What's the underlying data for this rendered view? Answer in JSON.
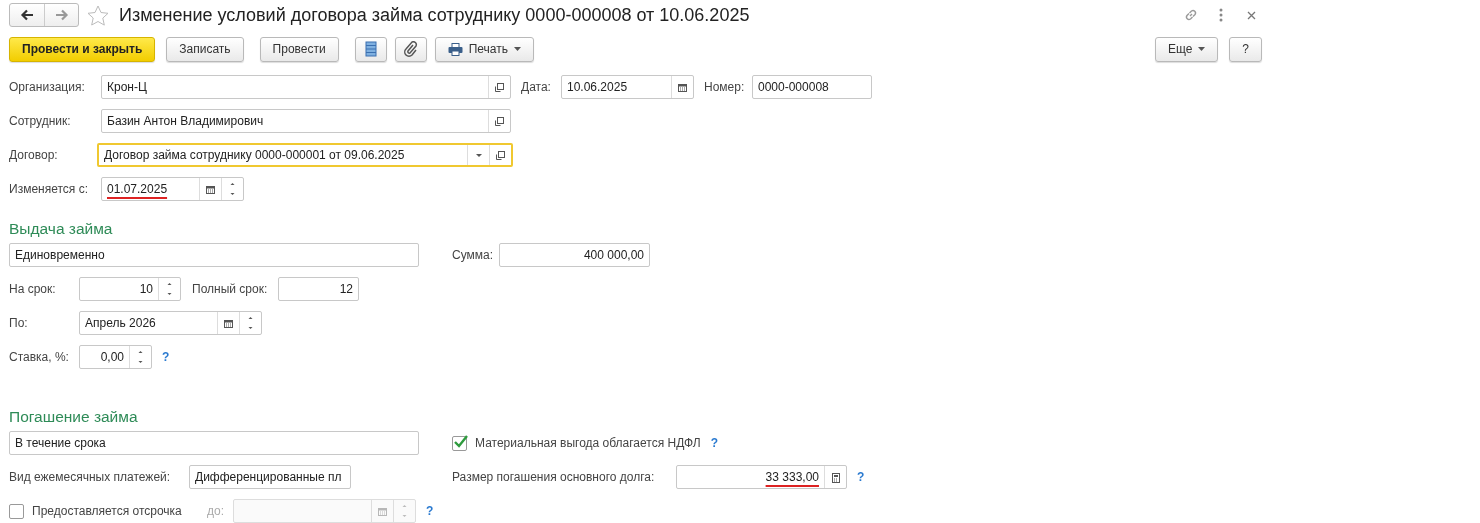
{
  "window": {
    "title": "Изменение условий договора займа сотруднику 0000-000008 от 10.06.2025"
  },
  "toolbar": {
    "left": [
      {
        "kind": "primary",
        "label": "Провести и закрыть"
      },
      {
        "kind": "button",
        "label": "Записать"
      },
      {
        "kind": "button",
        "label": "Провести"
      },
      {
        "kind": "list"
      },
      {
        "kind": "clip"
      },
      {
        "kind": "print-menu",
        "label": "Печать"
      }
    ],
    "right": [
      {
        "kind": "menu",
        "label": "Еще"
      },
      {
        "kind": "button",
        "label": "?"
      }
    ]
  },
  "header": {
    "organization": {
      "label": "Организация:",
      "value": "Крон-Ц"
    },
    "date": {
      "label": "Дата:",
      "value": "10.06.2025"
    },
    "number": {
      "label": "Номер:",
      "value": "0000-000008"
    },
    "employee": {
      "label": "Сотрудник:",
      "value": "Базин Антон Владимирович"
    },
    "contract": {
      "label": "Договор:",
      "value": "Договор займа сотруднику 0000-000001 от 09.06.2025",
      "focused": true
    },
    "change_from": {
      "label": "Изменяется с:",
      "value": "01.07.2025",
      "marked": true
    }
  },
  "issue": {
    "title": "Выдача займа",
    "method": {
      "value": "Единовременно"
    },
    "sum": {
      "label": "Сумма:",
      "value": "400 000,00"
    },
    "term": {
      "label": "На срок:",
      "value": "10"
    },
    "full_term": {
      "label": "Полный срок:",
      "value": "12"
    },
    "until": {
      "label": "По:",
      "value": "Апрель 2026"
    },
    "rate": {
      "label": "Ставка, %:",
      "value": "0,00",
      "help": "?"
    }
  },
  "repayment": {
    "title": "Погашение займа",
    "method": {
      "value": "В течение срока"
    },
    "payment_type": {
      "label": "Вид ежемесячных платежей:",
      "value": "Дифференцированные пл"
    },
    "deferral": {
      "label": "Предоставляется отсрочка",
      "checked": false,
      "until_label": "до:",
      "disabled": true,
      "help": "?"
    },
    "taxable": {
      "label": "Материальная выгода облагается НДФЛ",
      "checked": true,
      "help": "?"
    },
    "principal": {
      "label": "Размер погашения основного долга:",
      "value": "33 333,00",
      "marked": true,
      "help": "?"
    }
  }
}
